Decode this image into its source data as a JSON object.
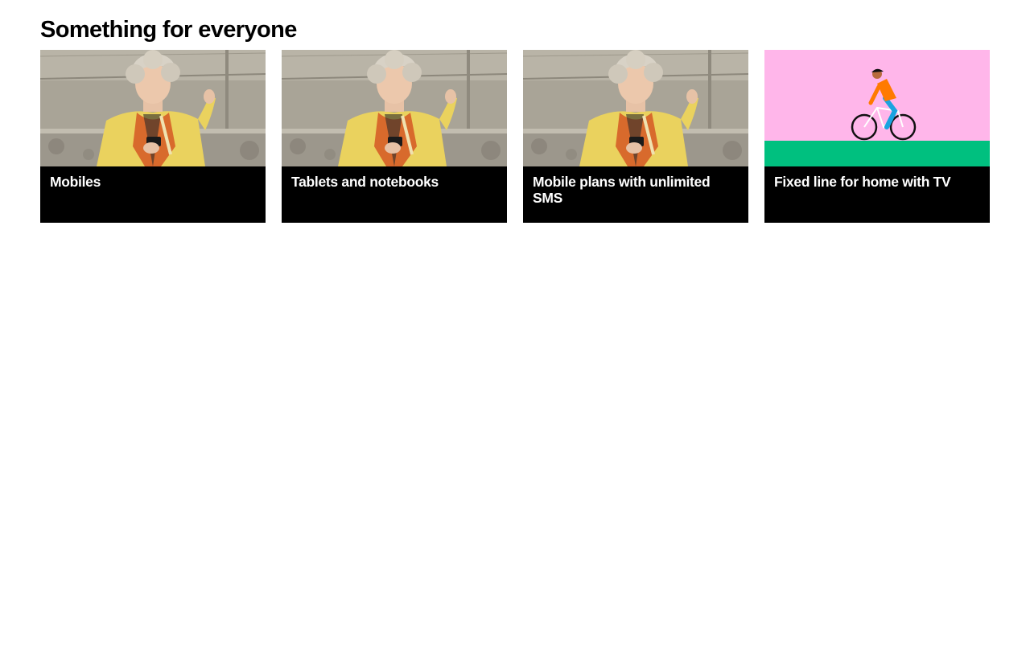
{
  "section": {
    "title": "Something for everyone"
  },
  "cards": [
    {
      "title": "Mobiles",
      "image": "woman-using-phone-photo"
    },
    {
      "title": "Tablets and notebooks",
      "image": "woman-using-phone-photo"
    },
    {
      "title": "Mobile plans with unlimited SMS",
      "image": "woman-using-phone-photo"
    },
    {
      "title": "Fixed line for home with TV",
      "image": "cyclist-illustration"
    }
  ],
  "colors": {
    "caption_background": "#000000",
    "caption_text": "#ffffff",
    "illustration_sky": "#ffb6ea",
    "illustration_ground": "#00c07f",
    "jacket_yellow": "#ead25e"
  }
}
